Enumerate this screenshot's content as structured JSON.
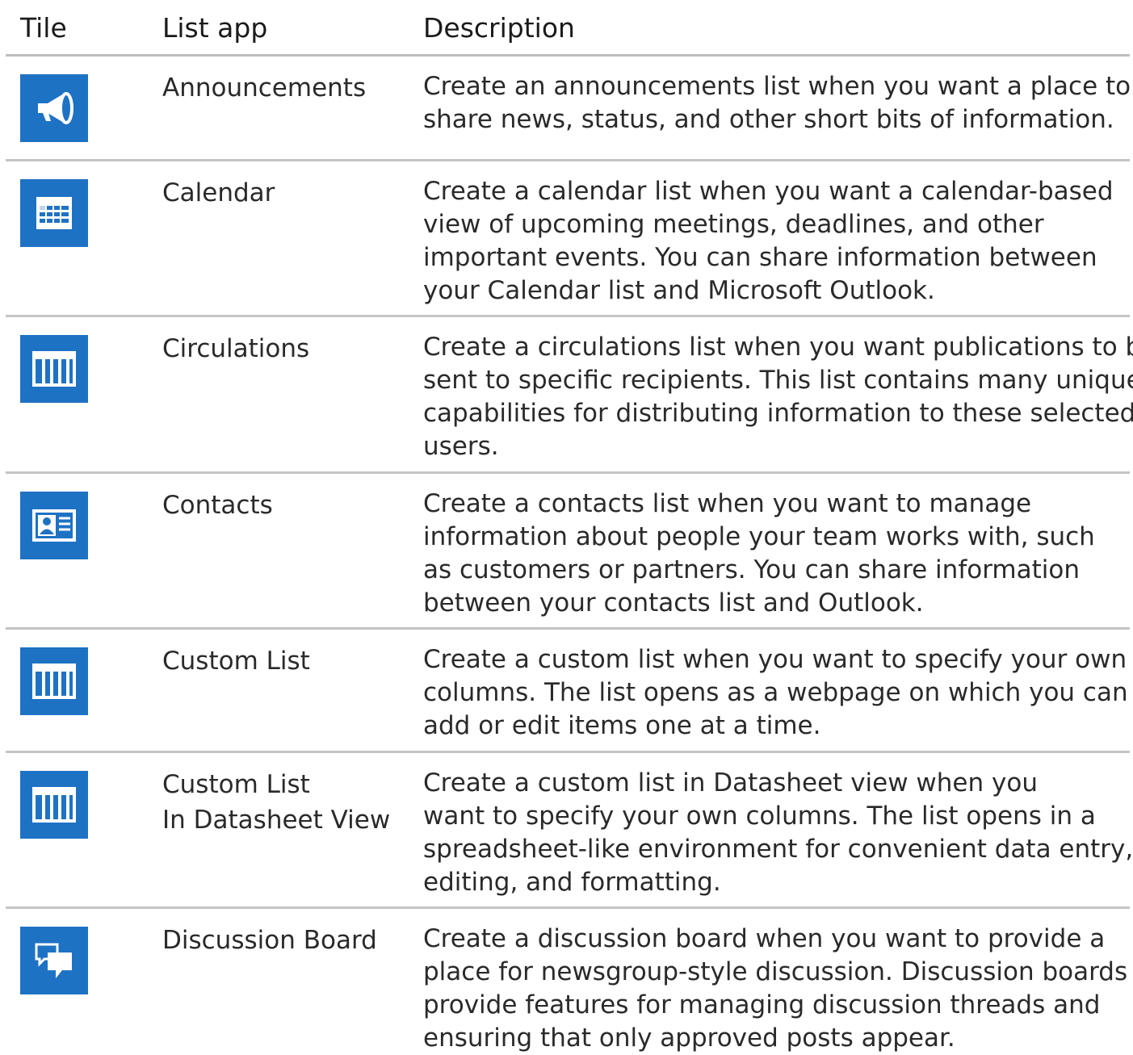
{
  "header": {
    "tile": "Tile",
    "list_app": "List app",
    "description": "Description"
  },
  "colors": {
    "tile_blue": "#1e72c4",
    "rule": "#c4c4c4"
  },
  "rows": [
    {
      "icon": "megaphone-icon",
      "name": "Announcements",
      "desc": [
        "Create an announcements list when you want a place to",
        "share news, status, and other short bits of information."
      ]
    },
    {
      "icon": "calendar-icon",
      "name": "Calendar",
      "desc": [
        "Create a calendar list when you want a calendar-based",
        "view of upcoming meetings, deadlines, and other",
        "important events. You can share information between",
        "your Calendar list and Microsoft Outlook."
      ]
    },
    {
      "icon": "list-columns-icon",
      "name": "Circulations",
      "desc": [
        "Create a circulations list when you want publications to be",
        "sent to specific recipients. This list contains many unique",
        "capabilities for distributing information to these selected",
        "users."
      ]
    },
    {
      "icon": "contact-card-icon",
      "name": "Contacts",
      "desc": [
        "Create a contacts list when you want to manage",
        "information about people your team works with, such",
        "as customers or partners. You can share information",
        "between your contacts list and Outlook."
      ]
    },
    {
      "icon": "list-columns-icon",
      "name": "Custom List",
      "desc": [
        "Create a custom list when you want to specify your own",
        "columns. The list opens as a webpage on which you can",
        "add or edit items one at a time."
      ]
    },
    {
      "icon": "list-columns-icon",
      "name": "Custom List\nIn Datasheet View",
      "desc": [
        "Create a custom list in Datasheet view when you",
        "want to specify your own columns. The list opens in a",
        "spreadsheet-like environment for convenient data entry,",
        "editing, and formatting."
      ]
    },
    {
      "icon": "discussion-icon",
      "name": "Discussion Board",
      "desc": [
        "Create a discussion board when you want to provide a",
        "place for newsgroup-style discussion. Discussion boards",
        "provide features for managing discussion threads and",
        "ensuring that only approved posts appear."
      ]
    }
  ]
}
